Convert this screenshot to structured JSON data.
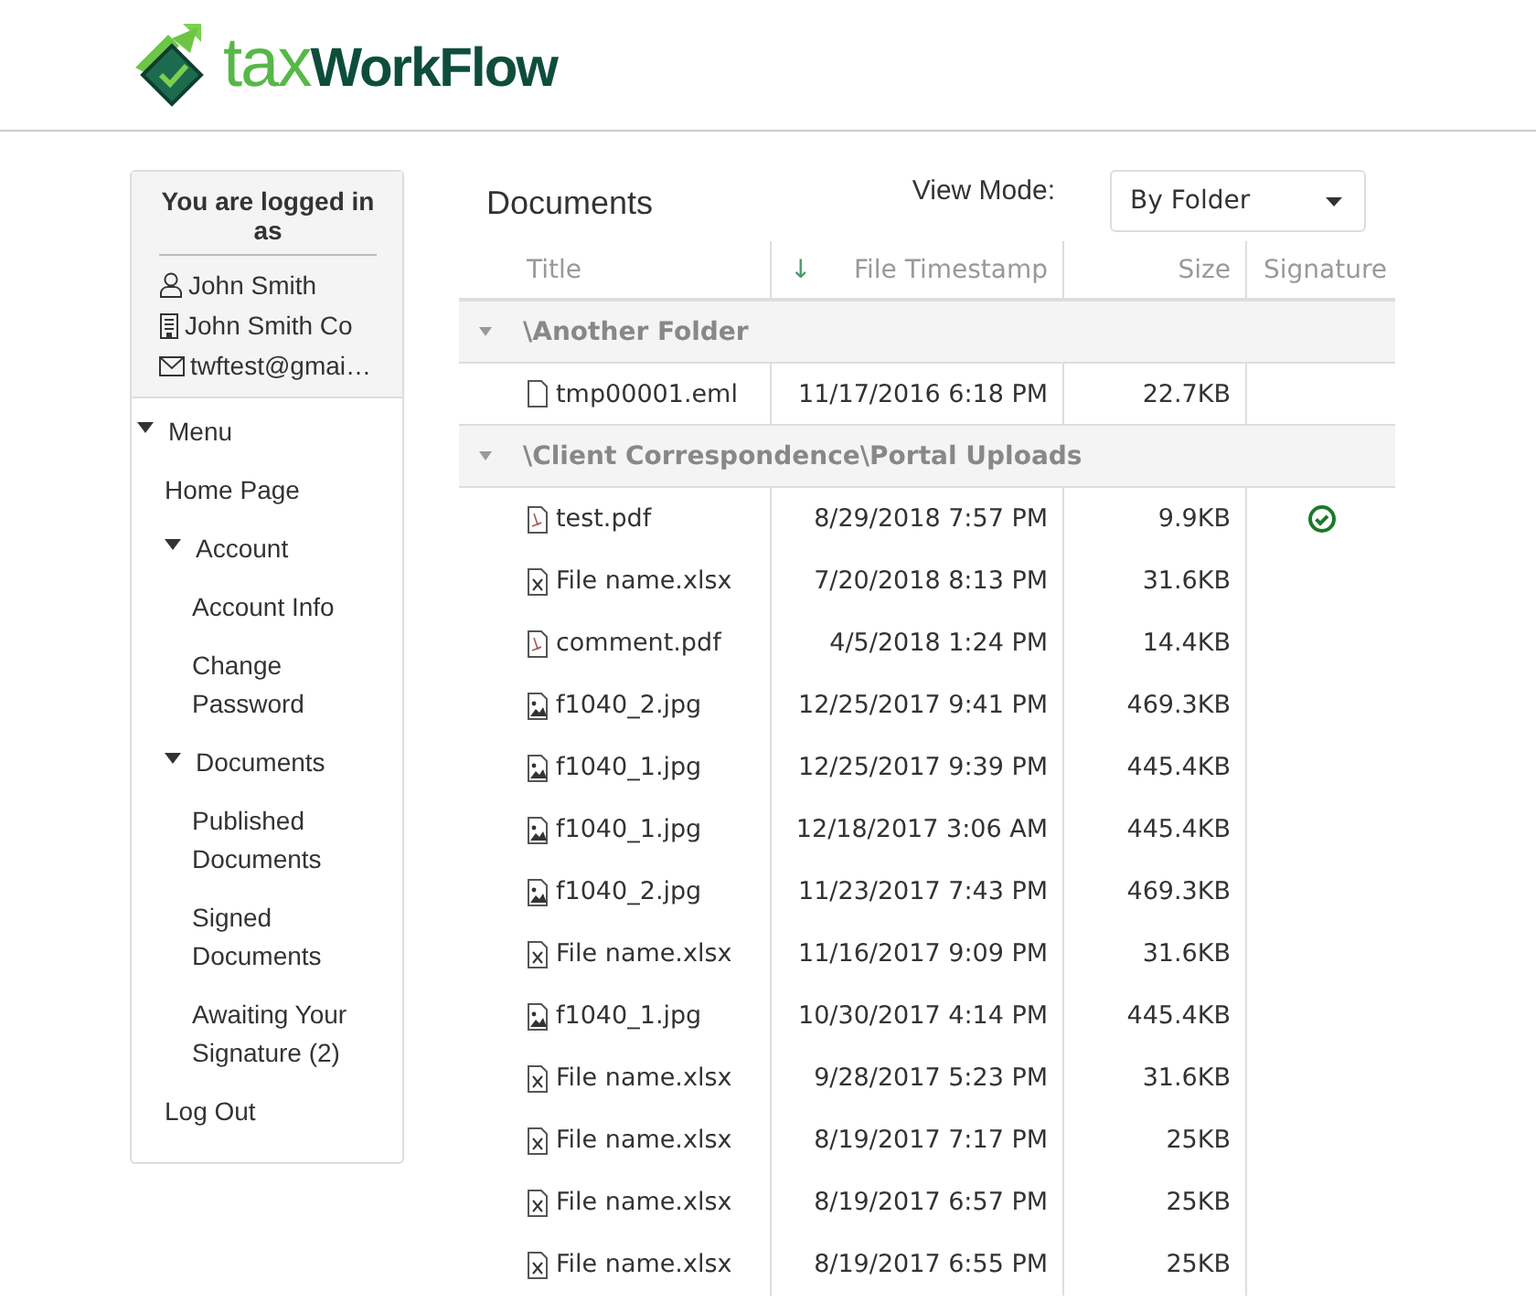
{
  "logo": {
    "part_1": "tax",
    "part_2": "WorkFlow"
  },
  "user_card": {
    "title": "You are logged in as",
    "lines": [
      {
        "kind": "person",
        "text": "John Smith"
      },
      {
        "kind": "company",
        "text": "John Smith Co"
      },
      {
        "kind": "email",
        "text": "twftest@gmai…"
      }
    ]
  },
  "menu": [
    {
      "label": "Menu",
      "expanded": true,
      "children": [
        {
          "label": "Home Page"
        },
        {
          "label": "Account",
          "expanded": true,
          "children": [
            {
              "label": "Account Info"
            },
            {
              "label": "Change Password"
            }
          ]
        },
        {
          "label": "Documents",
          "expanded": true,
          "children": [
            {
              "label": "Published Documents"
            },
            {
              "label": "Signed Documents"
            },
            {
              "label": "Awaiting Your Signature (2)"
            }
          ]
        },
        {
          "label": "Log Out"
        }
      ]
    }
  ],
  "page_title": "Documents",
  "view_mode": {
    "label": "View Mode:",
    "value": "By Folder"
  },
  "table": {
    "columns": [
      "Title",
      "File Timestamp",
      "Size",
      "Signature"
    ],
    "sort_icon": "↓",
    "groups": [
      {
        "name": "\\Another Folder",
        "expanded": true,
        "rows": [
          {
            "kind": "file",
            "title": "tmp00001.eml",
            "timestamp": "11/17/2016 6:18 PM",
            "size": "22.7KB",
            "signed": false
          }
        ]
      },
      {
        "name": "\\Client Correspondence\\Portal Uploads",
        "expanded": true,
        "rows": [
          {
            "kind": "pdf",
            "title": "test.pdf",
            "timestamp": "8/29/2018 7:57 PM",
            "size": "9.9KB",
            "signed": true
          },
          {
            "kind": "excel",
            "title": "File name.xlsx",
            "timestamp": "7/20/2018 8:13 PM",
            "size": "31.6KB",
            "signed": false
          },
          {
            "kind": "pdf",
            "title": "comment.pdf",
            "timestamp": "4/5/2018 1:24 PM",
            "size": "14.4KB",
            "signed": false
          },
          {
            "kind": "image",
            "title": "f1040_2.jpg",
            "timestamp": "12/25/2017 9:41 PM",
            "size": "469.3KB",
            "signed": false
          },
          {
            "kind": "image",
            "title": "f1040_1.jpg",
            "timestamp": "12/25/2017 9:39 PM",
            "size": "445.4KB",
            "signed": false
          },
          {
            "kind": "image",
            "title": "f1040_1.jpg",
            "timestamp": "12/18/2017 3:06 AM",
            "size": "445.4KB",
            "signed": false
          },
          {
            "kind": "image",
            "title": "f1040_2.jpg",
            "timestamp": "11/23/2017 7:43 PM",
            "size": "469.3KB",
            "signed": false
          },
          {
            "kind": "excel",
            "title": "File name.xlsx",
            "timestamp": "11/16/2017 9:09 PM",
            "size": "31.6KB",
            "signed": false
          },
          {
            "kind": "image",
            "title": "f1040_1.jpg",
            "timestamp": "10/30/2017 4:14 PM",
            "size": "445.4KB",
            "signed": false
          },
          {
            "kind": "excel",
            "title": "File name.xlsx",
            "timestamp": "9/28/2017 5:23 PM",
            "size": "31.6KB",
            "signed": false
          },
          {
            "kind": "excel",
            "title": "File name.xlsx",
            "timestamp": "8/19/2017 7:17 PM",
            "size": "25KB",
            "signed": false
          },
          {
            "kind": "excel",
            "title": "File name.xlsx",
            "timestamp": "8/19/2017 6:57 PM",
            "size": "25KB",
            "signed": false
          },
          {
            "kind": "excel",
            "title": "File name.xlsx",
            "timestamp": "8/19/2017 6:55 PM",
            "size": "25KB",
            "signed": false
          }
        ]
      }
    ]
  }
}
